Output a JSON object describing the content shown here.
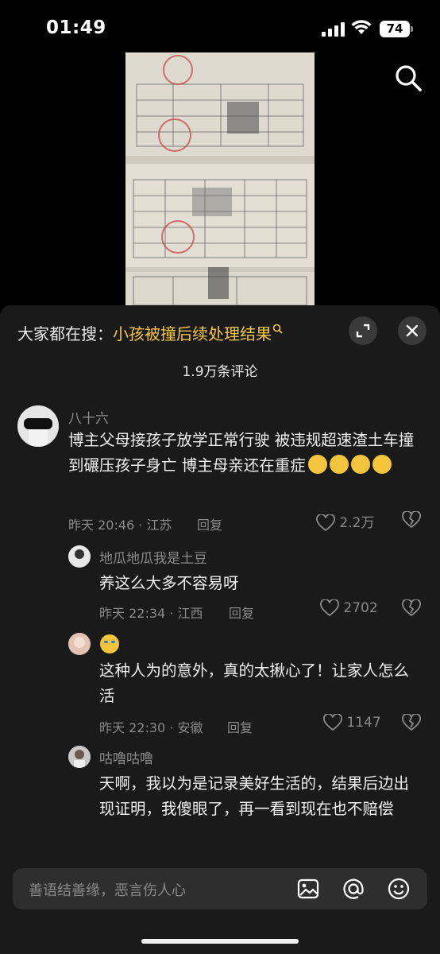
{
  "status": {
    "time": "01:49",
    "battery": "74"
  },
  "search_hint": {
    "label": "大家都在搜：",
    "query": "小孩被撞后续处理结果"
  },
  "comment_count": "1.9万条评论",
  "comments": [
    {
      "username": "八十六",
      "text": "博主父母接孩子放学正常行驶 被违规超速渣土车撞到碾压孩子身亡 博主母亲还在重症",
      "meta": "昨天 20:46 · 江苏",
      "reply": "回复",
      "likes": "2.2万"
    },
    {
      "username": "地瓜地瓜我是土豆",
      "text": "养这么大多不容易呀",
      "meta": "昨天 22:34 · 江西",
      "reply": "回复",
      "likes": "2702"
    },
    {
      "username": "",
      "text": "这种人为的意外，真的太揪心了！让家人怎么活",
      "meta": "昨天 22:30 · 安徽",
      "reply": "回复",
      "likes": "1147"
    },
    {
      "username": "咕噜咕噜",
      "text": "天啊，我以为是记录美好生活的，结果后边出现证明，我傻眼了，再一看到现在也不赔偿"
    }
  ],
  "input": {
    "placeholder": "善语结善缘，恶言伤人心"
  },
  "icons": {
    "search": "search-icon",
    "expand": "expand-icon",
    "close": "close-icon",
    "like": "heart-icon",
    "dislike": "broken-heart-icon",
    "image": "image-icon",
    "mention": "at-icon",
    "emoji": "emoji-icon"
  },
  "colors": {
    "accent": "#f6c544",
    "panel": "#1a1a1a",
    "muted": "#8a8a8a"
  }
}
